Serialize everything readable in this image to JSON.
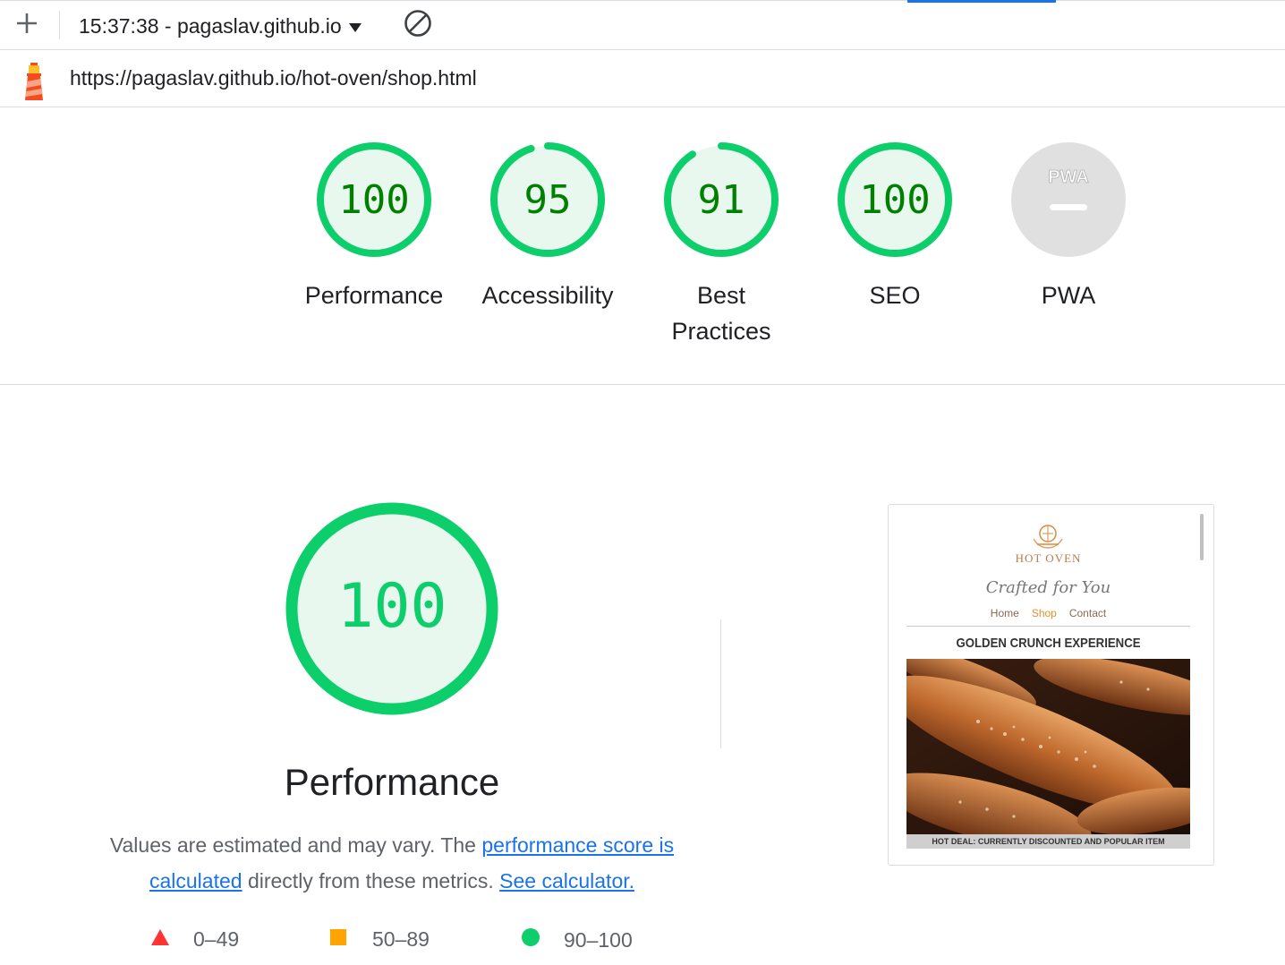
{
  "toolbar": {
    "add_icon": "plus-icon",
    "report_label": "15:37:38 - pagaslav.github.io",
    "dropdown_icon": "caret-down-icon",
    "clear_icon": "block-icon",
    "accent_color": "#1a73e8"
  },
  "urlbar": {
    "logo_icon": "lighthouse-icon",
    "url": "https://pagaslav.github.io/hot-oven/shop.html"
  },
  "gauges": [
    {
      "label": "Performance",
      "score": "100",
      "value": 100
    },
    {
      "label": "Accessibility",
      "score": "95",
      "value": 95
    },
    {
      "label_line1": "Best",
      "label_line2": "Practices",
      "score": "91",
      "value": 91
    },
    {
      "label": "SEO",
      "score": "100",
      "value": 100
    },
    {
      "label": "PWA",
      "badge": "PWA",
      "value": null
    }
  ],
  "colors": {
    "pass": "#0cce6b",
    "pass_text": "#008000",
    "pass_fill": "#e8f8ee",
    "average": "#ffa400",
    "fail": "#ff3333",
    "na": "#e0e0e0"
  },
  "performance": {
    "score": "100",
    "value": 100,
    "title": "Performance",
    "desc_part1": "Values are estimated and may vary. The ",
    "link1": "performance score is calculated",
    "desc_part2": " directly from these metrics. ",
    "link2": "See calculator."
  },
  "legend": [
    {
      "range": "0–49",
      "shape": "triangle"
    },
    {
      "range": "50–89",
      "shape": "square"
    },
    {
      "range": "90–100",
      "shape": "circle"
    }
  ],
  "screenshot": {
    "brand": "HOT OVEN",
    "tagline": "Crafted for You",
    "nav": [
      "Home",
      "Shop",
      "Contact"
    ],
    "active_nav": "Shop",
    "heading": "GOLDEN CRUNCH EXPERIENCE",
    "caption": "HOT DEAL: CURRENTLY DISCOUNTED AND POPULAR ITEM"
  }
}
